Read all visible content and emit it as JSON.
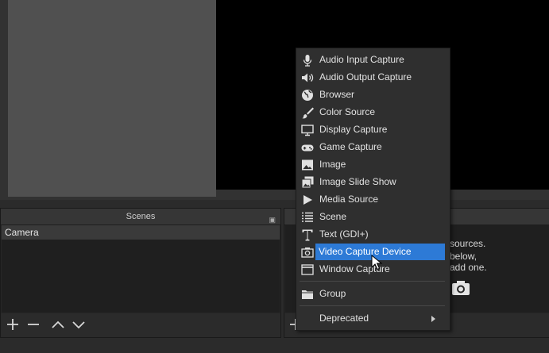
{
  "scenes_dock": {
    "title": "Scenes",
    "items": [
      "Camera"
    ]
  },
  "sources_dock": {
    "hint_lines": [
      "sources.",
      "below,",
      "add one."
    ]
  },
  "context_menu": {
    "items": [
      {
        "label": "Audio Input Capture",
        "icon": "microphone-icon"
      },
      {
        "label": "Audio Output Capture",
        "icon": "speaker-icon"
      },
      {
        "label": "Browser",
        "icon": "globe-icon"
      },
      {
        "label": "Color Source",
        "icon": "paintbrush-icon"
      },
      {
        "label": "Display Capture",
        "icon": "monitor-icon"
      },
      {
        "label": "Game Capture",
        "icon": "gamepad-icon"
      },
      {
        "label": "Image",
        "icon": "image-icon"
      },
      {
        "label": "Image Slide Show",
        "icon": "slideshow-icon"
      },
      {
        "label": "Media Source",
        "icon": "play-icon"
      },
      {
        "label": "Scene",
        "icon": "list-icon"
      },
      {
        "label": "Text (GDI+)",
        "icon": "text-icon"
      },
      {
        "label": "Video Capture Device",
        "icon": "camera-icon",
        "highlighted": true
      },
      {
        "label": "Window Capture",
        "icon": "window-icon"
      }
    ],
    "group_label": "Group",
    "deprecated_label": "Deprecated"
  },
  "colors": {
    "highlight": "#2d7ad6",
    "preview_canvas": "#000000",
    "dock_bg": "#272727"
  }
}
